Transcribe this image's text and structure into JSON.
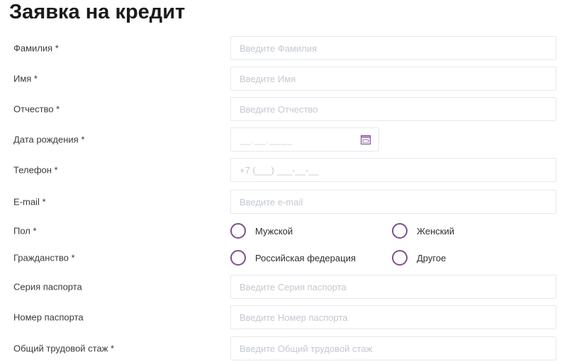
{
  "page": {
    "title": "Заявка на кредит"
  },
  "form": {
    "fields": [
      {
        "label": "Фамилия *",
        "placeholder": "Введите Фамилия"
      },
      {
        "label": "Имя *",
        "placeholder": "Введите Имя"
      },
      {
        "label": "Отчество *",
        "placeholder": "Введите Отчество"
      },
      {
        "label": "Дата рождения *",
        "placeholder": "__.__.____",
        "icon": "calendar-icon"
      },
      {
        "label": "Телефон *",
        "placeholder": "+7 (___) ___-__-__"
      },
      {
        "label": "E-mail *",
        "placeholder": "Введите e-mail"
      },
      {
        "label": "Пол *",
        "options": [
          "Мужской",
          "Женский"
        ]
      },
      {
        "label": "Гражданство *",
        "options": [
          "Российская федерация",
          "Другое"
        ]
      },
      {
        "label": "Серия паспорта",
        "placeholder": "Введите Серия паспорта"
      },
      {
        "label": "Номер паспорта",
        "placeholder": "Введите Номер паспорта"
      },
      {
        "label": "Общий трудовой стаж *",
        "placeholder": "Введите Общий трудовой стаж"
      }
    ]
  },
  "colors": {
    "accent_purple": "#7e4e8e",
    "input_border": "#e7e8ec",
    "placeholder_text": "#c3c8d1",
    "label_text": "#3a3a3a",
    "title_text": "#1b1b1b"
  }
}
